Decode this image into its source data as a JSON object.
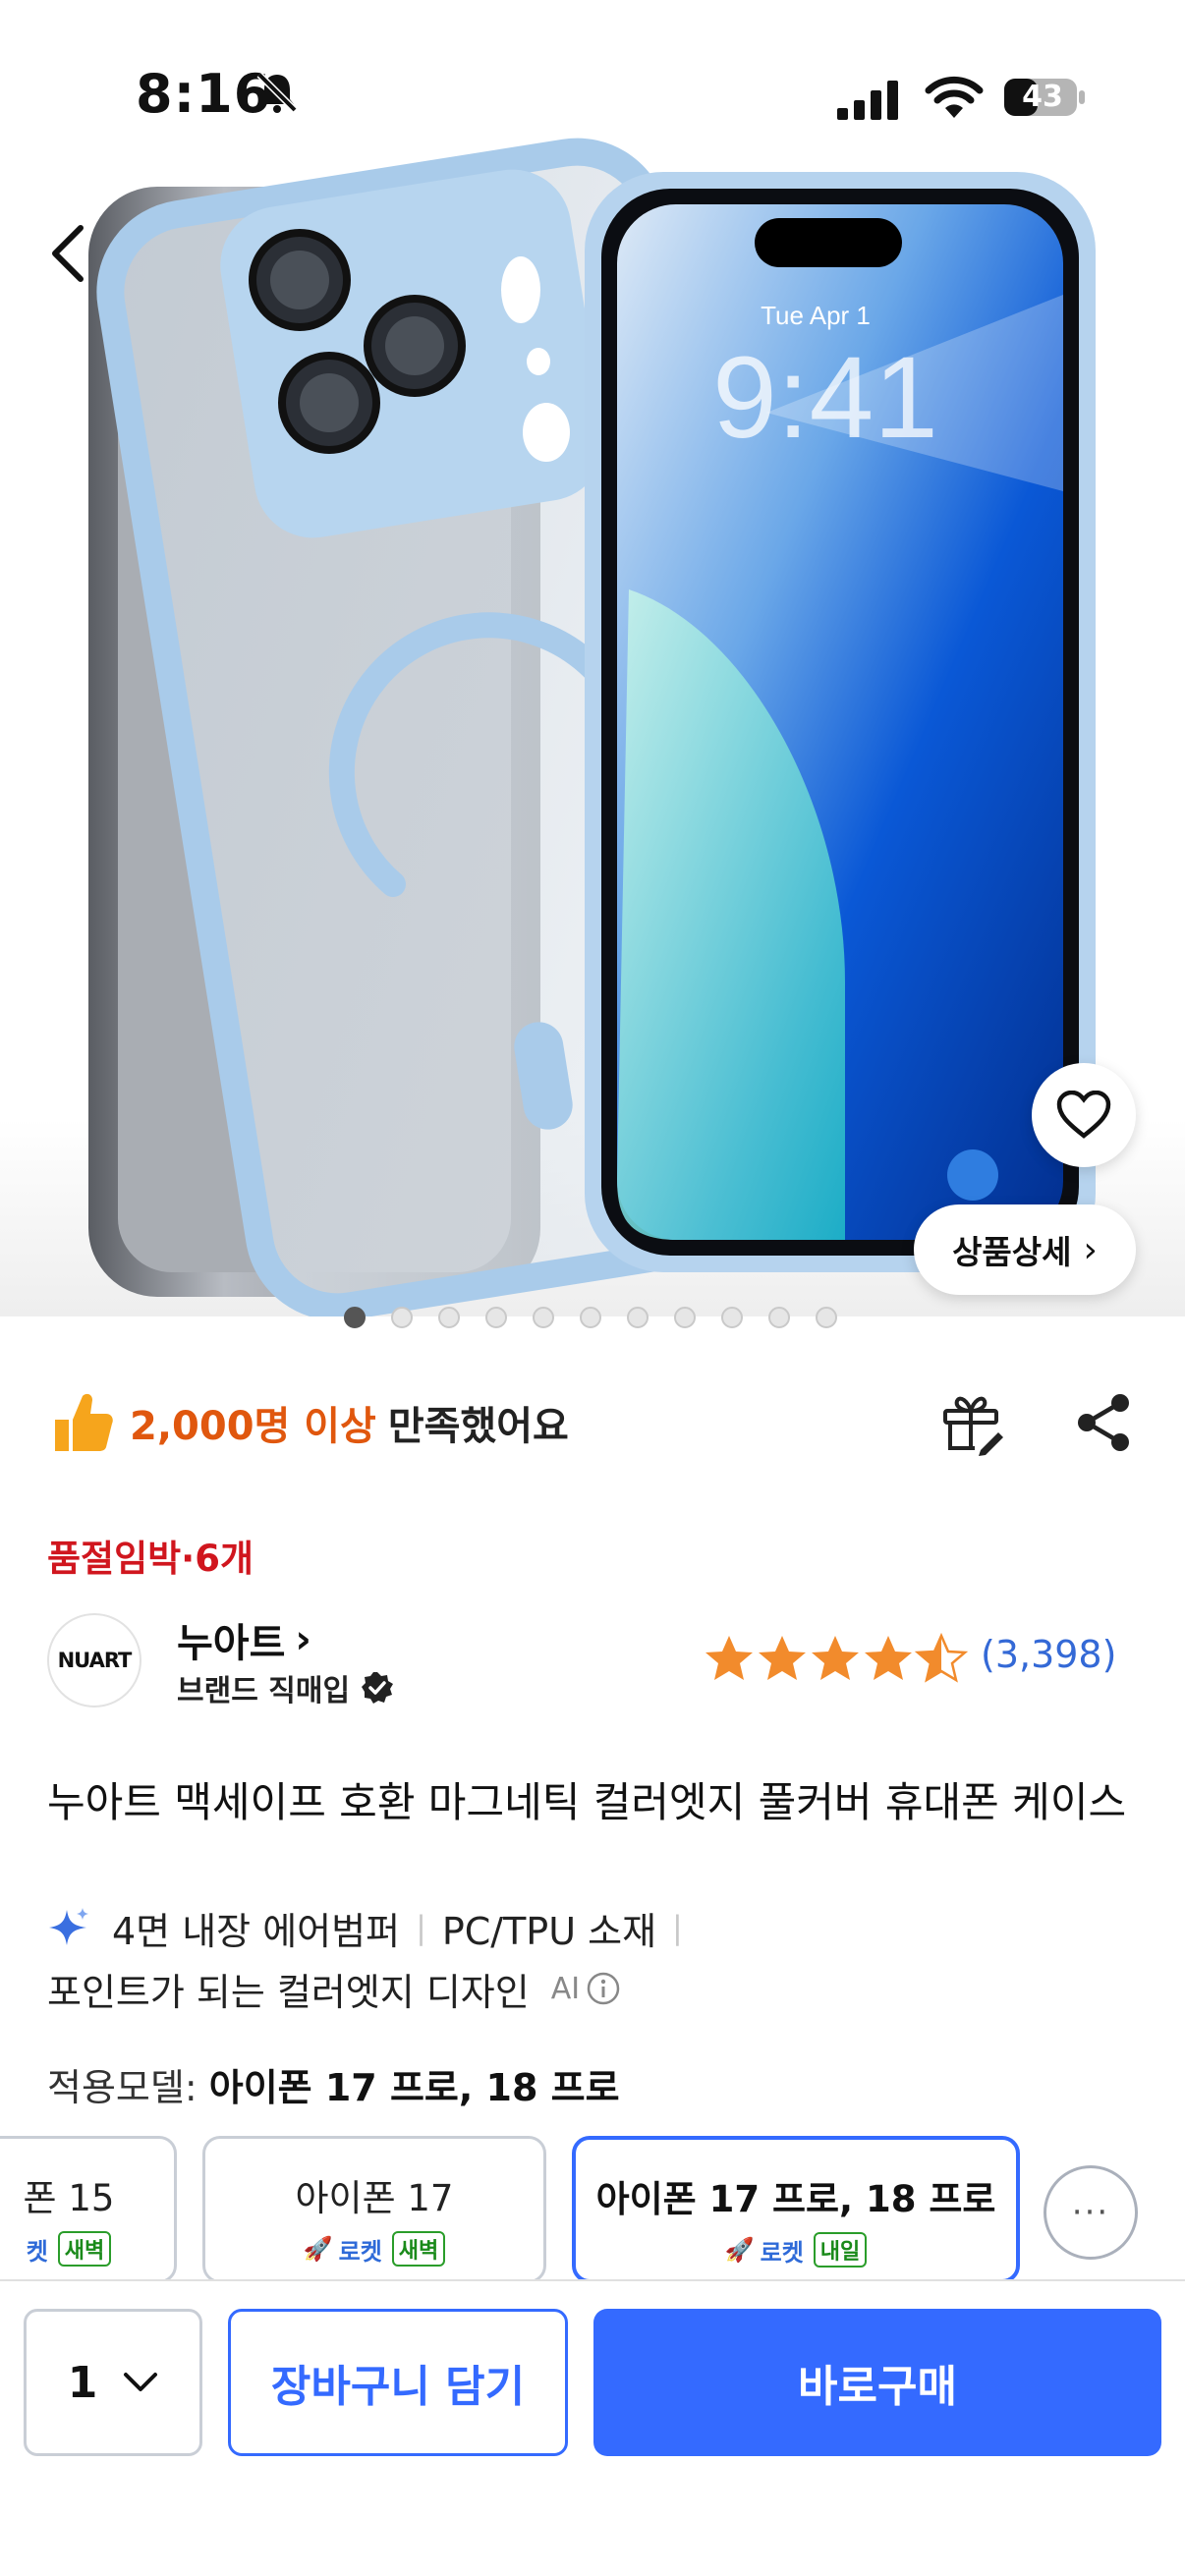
{
  "status_bar": {
    "time": "8:16",
    "battery": "43",
    "icons": [
      "bell-slash-icon",
      "cellular-signal-icon",
      "wifi-icon",
      "battery-icon"
    ]
  },
  "hero": {
    "image": "product-photo-phone-case",
    "phone_lock_date": "Tue Apr 1",
    "phone_lock_time": "9:41",
    "detail_button": "상품상세",
    "carousel_total": 11,
    "carousel_active": 0
  },
  "satisfaction": {
    "highlight": "2,000명 이상",
    "rest": "만족했어요"
  },
  "stock_notice": "품절임박·6개",
  "brand": {
    "logo_text": "NUART",
    "name": "누아트",
    "subtitle": "브랜드 직매입",
    "rating": 4.5,
    "review_count": "(3,398)"
  },
  "product": {
    "title": "누아트 맥세이프 호환 마그네틱 컬러엣지 풀커버 휴대폰 케이스",
    "features_line1": [
      "4면 내장 에어범퍼",
      "PC/TPU 소재"
    ],
    "features_line2": "포인트가 되는 컬러엣지 디자인",
    "ai_label": "AI"
  },
  "model_selector": {
    "label": "적용모델: ",
    "selected_value": "아이폰 17 프로, 18 프로",
    "options": [
      {
        "name": "폰 15",
        "rocket": "켓",
        "badge": "새벽"
      },
      {
        "name": "아이폰 17",
        "rocket": "로켓",
        "badge": "새벽"
      },
      {
        "name": "아이폰 17 프로, 18 프로",
        "rocket": "로켓",
        "badge": "내일"
      }
    ],
    "more": "···"
  },
  "bottom_bar": {
    "quantity": "1",
    "cart_button": "장바구니 담기",
    "buy_button": "바로구매"
  },
  "colors": {
    "primary_blue": "#346aff",
    "orange_highlight": "#e0570e",
    "stock_red": "#d0161e",
    "star_orange": "#f28b2c",
    "review_blue": "#3469d6"
  }
}
